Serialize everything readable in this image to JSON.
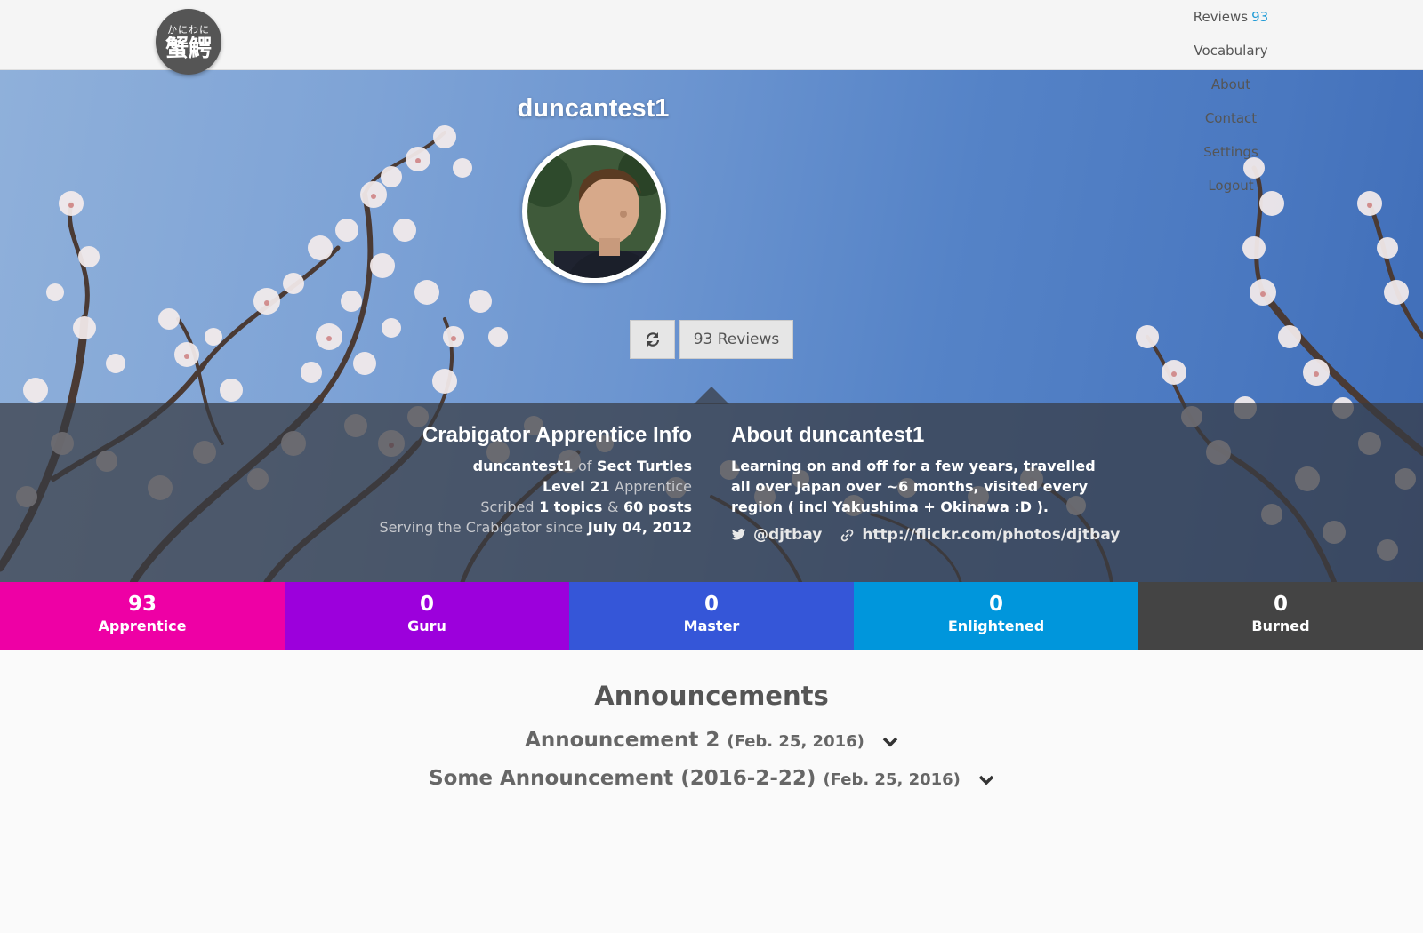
{
  "logo": {
    "kana": "かにわに",
    "kanji": "蟹鰐"
  },
  "nav": {
    "items": [
      {
        "label": "Reviews",
        "count": "93"
      },
      {
        "label": "Vocabulary"
      },
      {
        "label": "About"
      },
      {
        "label": "Contact"
      },
      {
        "label": "Settings"
      },
      {
        "label": "Logout"
      }
    ]
  },
  "profile": {
    "username": "duncantest1",
    "reviews_button": "93 Reviews"
  },
  "info": {
    "title": "Crabigator Apprentice Info",
    "user": "duncantest1",
    "of": "of",
    "sect": "Sect Turtles",
    "level": "Level 21",
    "rank": "Apprentice",
    "scribed": "Scribed",
    "topics": "1 topics",
    "amp": "&",
    "posts": "60 posts",
    "serving": "Serving the Crabigator since",
    "since_date": "July 04, 2012"
  },
  "about": {
    "title": "About duncantest1",
    "text": "Learning on and off for a few years, travelled all over Japan over ~6 months, visited every region ( incl Yakushima + Okinawa :D ).",
    "twitter": "@djtbay",
    "website": "http://flickr.com/photos/djtbay"
  },
  "srs": [
    {
      "count": "93",
      "label": "Apprentice",
      "color": "#ee00a5"
    },
    {
      "count": "0",
      "label": "Guru",
      "color": "#9c00dc"
    },
    {
      "count": "0",
      "label": "Master",
      "color": "#3556d8"
    },
    {
      "count": "0",
      "label": "Enlightened",
      "color": "#0096dc"
    },
    {
      "count": "0",
      "label": "Burned",
      "color": "#444444"
    }
  ],
  "announcements": {
    "title": "Announcements",
    "items": [
      {
        "title": "Announcement 2",
        "date": "(Feb. 25, 2016)"
      },
      {
        "title": "Some Announcement (2016-2-22)",
        "date": "(Feb. 25, 2016)"
      }
    ]
  }
}
